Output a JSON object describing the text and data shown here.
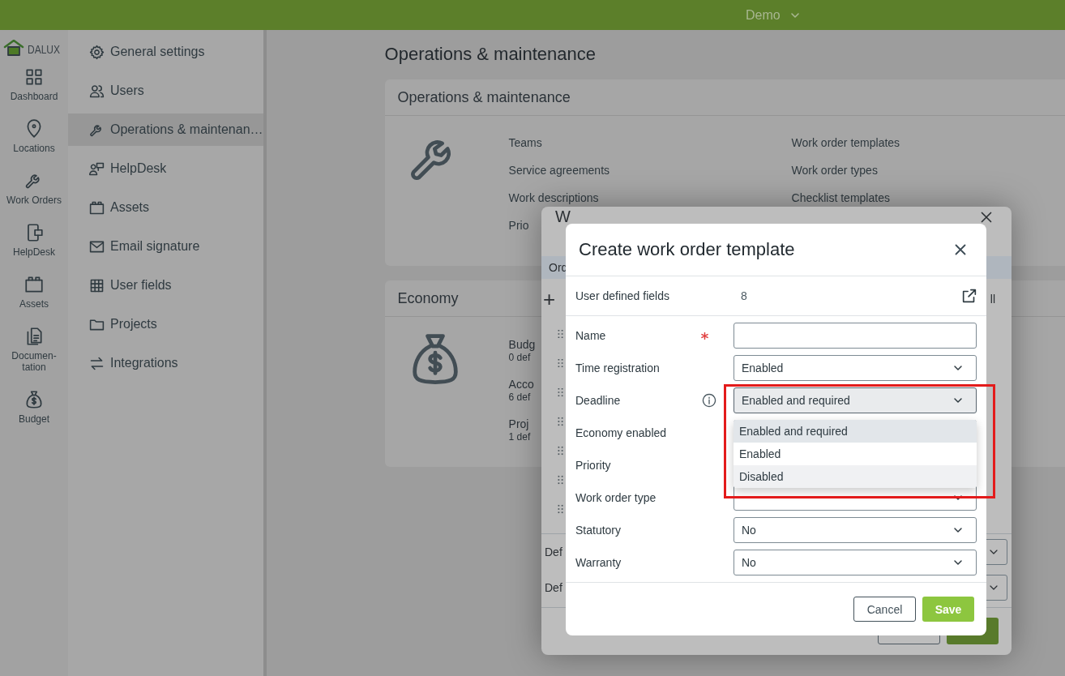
{
  "topbar": {
    "project": "Demo"
  },
  "logo": {
    "text": "DALUX"
  },
  "rail": [
    {
      "kind": "dashboard",
      "label": "Dashboard"
    },
    {
      "kind": "locations",
      "label": "Locations"
    },
    {
      "kind": "work-orders",
      "label": "Work Orders"
    },
    {
      "kind": "helpdesk",
      "label": "HelpDesk"
    },
    {
      "kind": "assets",
      "label": "Assets"
    },
    {
      "kind": "documentation",
      "label": "Documen-tation"
    },
    {
      "kind": "budget",
      "label": "Budget"
    }
  ],
  "sidebar": [
    {
      "kind": "settings",
      "label": "General settings",
      "selected": false
    },
    {
      "kind": "users",
      "label": "Users",
      "selected": false
    },
    {
      "kind": "wrench",
      "label": "Operations & maintenan…",
      "selected": true
    },
    {
      "kind": "person-sign",
      "label": "HelpDesk",
      "selected": false
    },
    {
      "kind": "assets",
      "label": "Assets",
      "selected": false
    },
    {
      "kind": "mail",
      "label": "Email signature",
      "selected": false
    },
    {
      "kind": "table",
      "label": "User fields",
      "selected": false
    },
    {
      "kind": "folder",
      "label": "Projects",
      "selected": false
    },
    {
      "kind": "swap",
      "label": "Integrations",
      "selected": false
    }
  ],
  "page_title": "Operations & maintenance",
  "maintenance_card": {
    "title": "Operations & maintenance",
    "links_column_1": [
      "Teams",
      "Service agreements",
      "Work descriptions",
      "Prio"
    ],
    "links_column_2": [
      "Work order templates",
      "Work order types",
      "Checklist templates"
    ]
  },
  "economy_card": {
    "title": "Economy",
    "items": [
      {
        "name": "Budg",
        "detail": "0 def"
      },
      {
        "name": "Acco",
        "detail": "6 def"
      },
      {
        "name": "Proj",
        "detail": "1 def"
      }
    ]
  },
  "background_dialog": {
    "title": "W",
    "tab": "Ord",
    "add": "+",
    "toolbar_text": "ll",
    "rows": [
      "Def",
      "Def"
    ]
  },
  "dialog": {
    "title": "Create work order template",
    "summary": {
      "label": "User defined fields",
      "value": "8"
    },
    "fields": [
      {
        "label": "Name",
        "kind": "text",
        "required": true,
        "info": false,
        "open": false
      },
      {
        "label": "Time registration",
        "kind": "select",
        "value": "Enabled",
        "required": false,
        "info": false,
        "open": false
      },
      {
        "label": "Deadline",
        "kind": "select",
        "value": "Enabled and required",
        "required": false,
        "info": true,
        "open": true
      },
      {
        "label": "Economy enabled",
        "kind": "select",
        "required": false,
        "info": false,
        "open": false
      },
      {
        "label": "Priority",
        "kind": "select",
        "required": false,
        "info": false,
        "open": false
      },
      {
        "label": "Work order type",
        "kind": "select",
        "required": false,
        "info": false,
        "open": false
      },
      {
        "label": "Statutory",
        "kind": "select",
        "value": "No",
        "required": false,
        "info": false,
        "open": false
      },
      {
        "label": "Warranty",
        "kind": "select",
        "value": "No",
        "required": false,
        "info": false,
        "open": false
      }
    ],
    "dropdown": [
      {
        "label": "Enabled and required",
        "selected": true,
        "highlighted": false
      },
      {
        "label": "Enabled",
        "selected": false,
        "highlighted": false
      },
      {
        "label": "Disabled",
        "selected": false,
        "highlighted": true
      }
    ],
    "cancel": "Cancel",
    "save": "Save"
  }
}
